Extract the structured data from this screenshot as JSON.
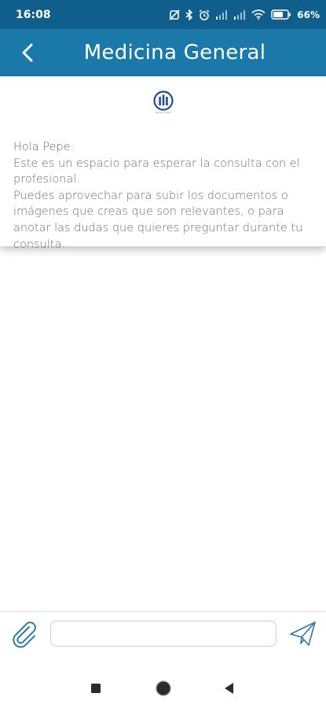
{
  "status_bar": {
    "time": "16:08",
    "battery_percent": "66"
  },
  "app_bar": {
    "title": "Medicina General"
  },
  "welcome": {
    "logo_caption": "Sanitas salud",
    "lines": [
      "Hola Pepe:",
      "Este es un espacio para esperar la consulta con el profesional.",
      "Puedes aprovechar para subir los documentos o imágenes que creas que son relevantes, o para anotar las dudas que quieres preguntar durante tu consulta."
    ]
  },
  "composer": {
    "input_value": "",
    "placeholder": ""
  },
  "colors": {
    "status_bar_bg": "#0f5e8c",
    "app_bar_bg": "#1a79a8",
    "logo_blue": "#1d4f91",
    "icon_blue": "#2f78a6"
  },
  "icons": {
    "back": "chevron-left-icon",
    "attach": "paperclip-icon",
    "send": "paper-plane-icon",
    "nav_recents": "square-icon",
    "nav_home": "circle-icon",
    "nav_back": "triangle-left-icon"
  }
}
